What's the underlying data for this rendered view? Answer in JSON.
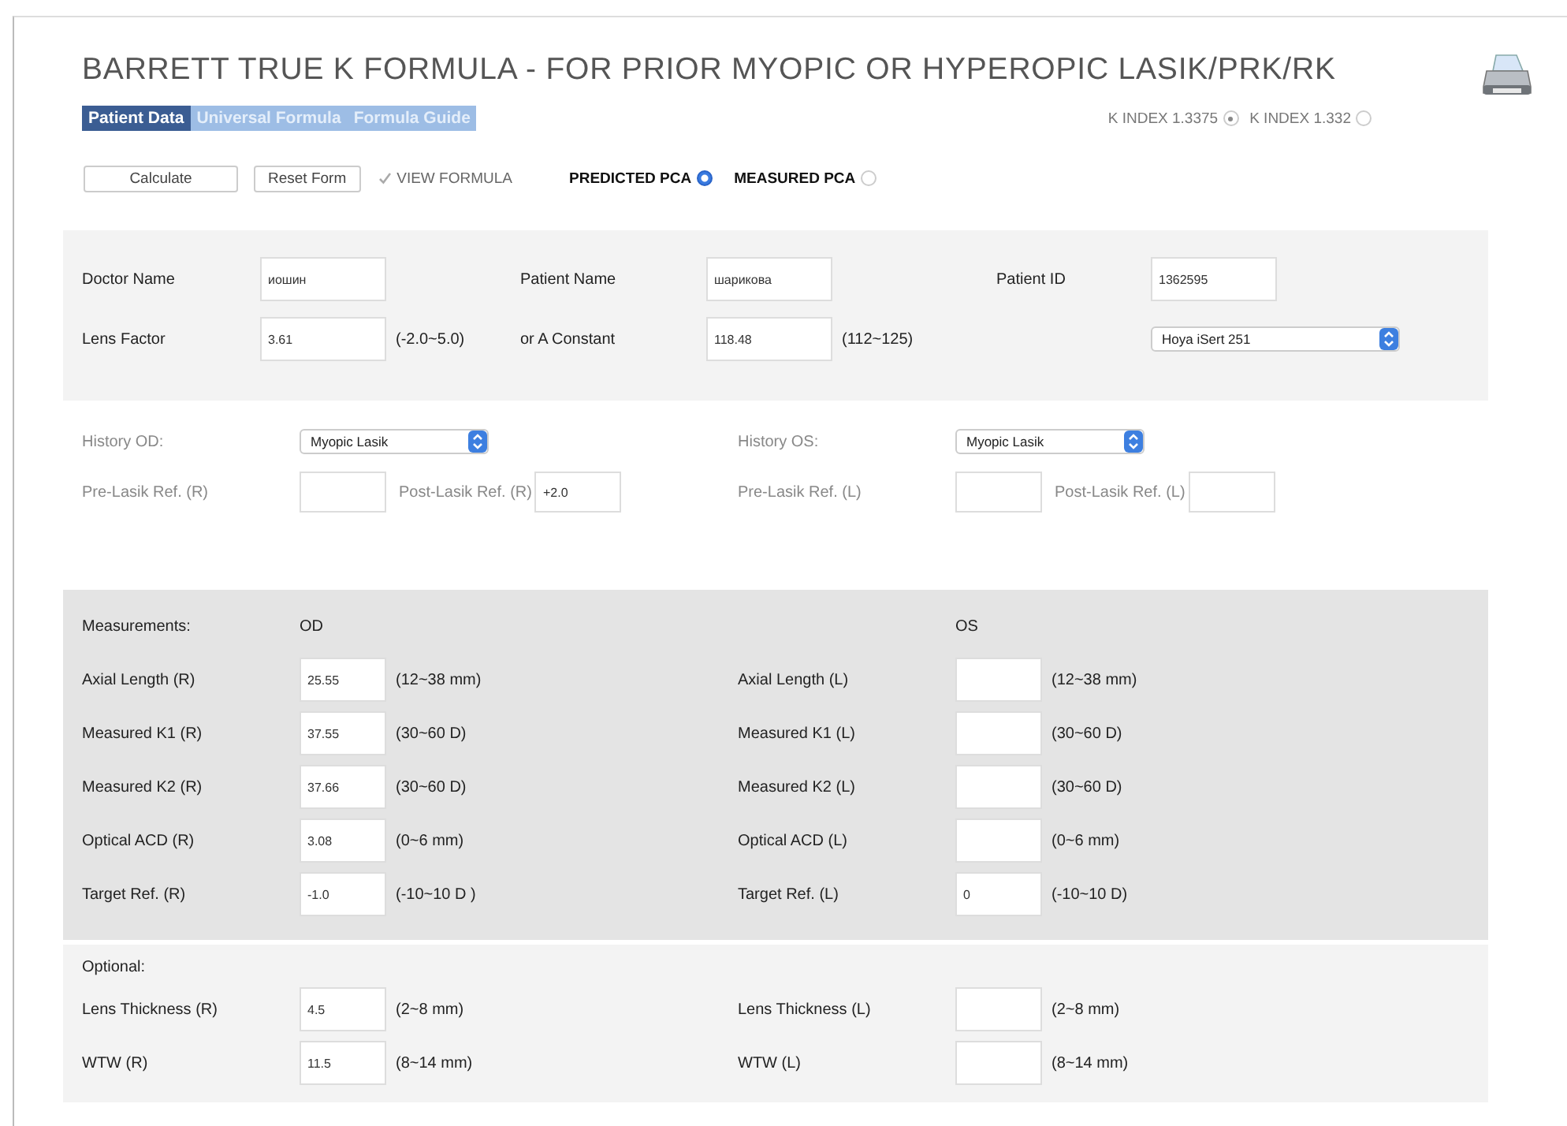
{
  "title": "BARRETT TRUE K FORMULA - FOR PRIOR MYOPIC OR HYPEROPIC LASIK/PRK/RK",
  "tabs": [
    {
      "label": "Patient Data",
      "selected": true
    },
    {
      "label": "Universal Formula",
      "selected": false
    },
    {
      "label": "Formula Guide",
      "selected": false
    }
  ],
  "k_index": [
    {
      "label": "K INDEX 1.3375",
      "selected": true
    },
    {
      "label": "K INDEX 1.332",
      "selected": false
    }
  ],
  "buttons": [
    "Calculate",
    "Reset Form"
  ],
  "view_formula": {
    "label": "VIEW FORMULA",
    "checked": true
  },
  "pca": [
    {
      "label": "PREDICTED PCA",
      "selected": true
    },
    {
      "label": "MEASURED PCA",
      "selected": false
    }
  ],
  "sections": [
    {
      "kind": "patient",
      "columns": [
        {
          "rows": [
            [
              {
                "kind": "label",
                "text": "Doctor Name"
              },
              {
                "kind": "input",
                "value": "иошин"
              }
            ],
            [
              {
                "kind": "label",
                "text": "Lens Factor"
              },
              {
                "kind": "input",
                "value": "3.61"
              },
              {
                "kind": "note",
                "text": "(-2.0~5.0)"
              }
            ]
          ]
        },
        {
          "rows": [
            [
              {
                "kind": "label",
                "text": "Patient Name"
              },
              {
                "kind": "input",
                "value": "шарикова"
              }
            ],
            [
              {
                "kind": "label",
                "text": "or  A Constant"
              },
              {
                "kind": "input",
                "value": "118.48"
              },
              {
                "kind": "note",
                "text": "(112~125)"
              }
            ]
          ]
        },
        {
          "rows": [
            [
              {
                "kind": "label",
                "text": "Patient ID"
              },
              {
                "kind": "input",
                "value": "1362595"
              }
            ],
            [
              {
                "kind": "gap"
              },
              {
                "kind": "select",
                "value": "Hoya iSert 251"
              }
            ]
          ]
        }
      ]
    },
    {
      "kind": "history",
      "columns": [
        {
          "rows": [
            [
              {
                "kind": "label",
                "text": "History OD:"
              },
              {
                "kind": "select",
                "value": "Myopic Lasik"
              }
            ],
            [
              {
                "kind": "label",
                "text": "Pre-Lasik Ref. (R)"
              },
              {
                "kind": "input"
              },
              {
                "kind": "inline_label",
                "text": "Post-Lasik Ref. (R)"
              },
              {
                "kind": "input",
                "value": "+2.0"
              }
            ]
          ]
        },
        {
          "rows": [
            [
              {
                "kind": "label",
                "text": "History OS:"
              },
              {
                "kind": "select",
                "value": "Myopic Lasik"
              }
            ],
            [
              {
                "kind": "label",
                "text": "Pre-Lasik Ref. (L)"
              },
              {
                "kind": "input"
              },
              {
                "kind": "inline_label",
                "text": "Post-Lasik Ref. (L)"
              },
              {
                "kind": "input"
              }
            ]
          ]
        }
      ]
    },
    {
      "kind": "measurements",
      "columns": [
        {
          "rows": [
            [
              {
                "kind": "label",
                "text": "Measurements:"
              },
              {
                "kind": "heading",
                "text": "OD"
              }
            ],
            [
              {
                "kind": "label",
                "text": "Axial Length (R)"
              },
              {
                "kind": "input",
                "value": "25.55"
              },
              {
                "kind": "note",
                "text": "(12~38 mm)"
              }
            ],
            [
              {
                "kind": "label",
                "text": "Measured K1 (R)"
              },
              {
                "kind": "input",
                "value": "37.55"
              },
              {
                "kind": "note",
                "text": "(30~60 D)"
              }
            ],
            [
              {
                "kind": "label",
                "text": "Measured K2 (R)"
              },
              {
                "kind": "input",
                "value": "37.66"
              },
              {
                "kind": "note",
                "text": "(30~60 D)"
              }
            ],
            [
              {
                "kind": "label",
                "text": "Optical ACD (R)"
              },
              {
                "kind": "input",
                "value": "3.08"
              },
              {
                "kind": "note",
                "text": "(0~6 mm)"
              }
            ],
            [
              {
                "kind": "label",
                "text": "Target Ref. (R)"
              },
              {
                "kind": "input",
                "value": "-1.0"
              },
              {
                "kind": "note",
                "text": "(-10~10 D )"
              }
            ]
          ]
        },
        {
          "rows": [
            [
              {
                "kind": "gap"
              },
              {
                "kind": "heading",
                "text": "OS"
              }
            ],
            [
              {
                "kind": "label",
                "text": "Axial Length (L)"
              },
              {
                "kind": "input"
              },
              {
                "kind": "note",
                "text": "(12~38 mm)"
              }
            ],
            [
              {
                "kind": "label",
                "text": "Measured K1 (L)"
              },
              {
                "kind": "input"
              },
              {
                "kind": "note",
                "text": "(30~60 D)"
              }
            ],
            [
              {
                "kind": "label",
                "text": "Measured K2 (L)"
              },
              {
                "kind": "input"
              },
              {
                "kind": "note",
                "text": "(30~60 D)"
              }
            ],
            [
              {
                "kind": "label",
                "text": "Optical ACD (L)"
              },
              {
                "kind": "input"
              },
              {
                "kind": "note",
                "text": "(0~6 mm)"
              }
            ],
            [
              {
                "kind": "label",
                "text": "Target Ref. (L)"
              },
              {
                "kind": "input",
                "value": "0"
              },
              {
                "kind": "note",
                "text": "(-10~10 D)"
              }
            ]
          ]
        }
      ]
    },
    {
      "kind": "optional",
      "heading": "Optional:",
      "columns": [
        {
          "rows": [
            [
              {
                "kind": "label",
                "text": "Lens Thickness (R)"
              },
              {
                "kind": "input",
                "value": "4.5"
              },
              {
                "kind": "note",
                "text": "(2~8 mm)"
              }
            ],
            [
              {
                "kind": "label",
                "text": "WTW (R)"
              },
              {
                "kind": "input",
                "value": "11.5"
              },
              {
                "kind": "note",
                "text": "(8~14 mm)"
              }
            ]
          ]
        },
        {
          "rows": [
            [
              {
                "kind": "label",
                "text": "Lens Thickness (L)"
              },
              {
                "kind": "input"
              },
              {
                "kind": "note",
                "text": "(2~8 mm)"
              }
            ],
            [
              {
                "kind": "label",
                "text": "WTW (L)"
              },
              {
                "kind": "input"
              },
              {
                "kind": "note",
                "text": "(8~14 mm)"
              }
            ]
          ]
        }
      ]
    }
  ]
}
